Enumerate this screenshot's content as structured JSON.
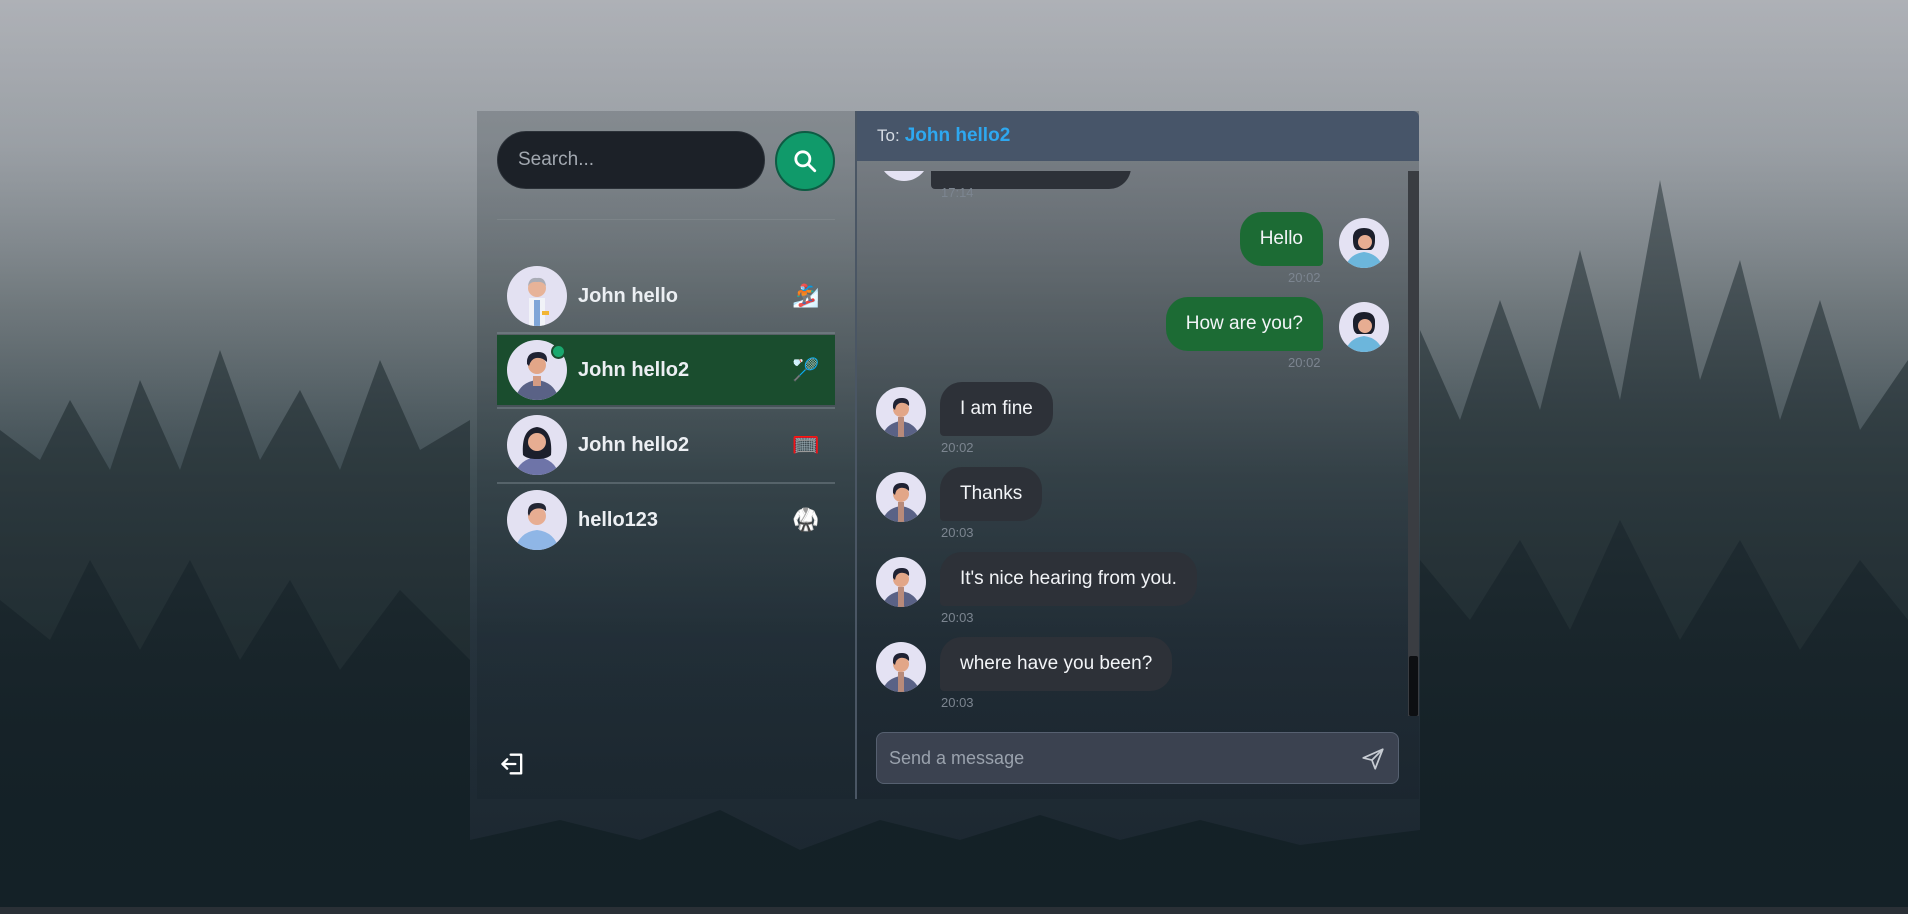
{
  "search": {
    "placeholder": "Search..."
  },
  "contacts": [
    {
      "name": "John hello",
      "emoji": "🏂"
    },
    {
      "name": "John hello2",
      "emoji": "🏸"
    },
    {
      "name": "John hello2",
      "emoji": "🥅"
    },
    {
      "name": "hello123",
      "emoji": "🥋"
    }
  ],
  "chat": {
    "to_label": "To:",
    "recipient": "John hello2",
    "messages": [
      {
        "text": "",
        "time": "17:14",
        "direction": "incoming"
      },
      {
        "text": "Hello",
        "time": "20:02",
        "direction": "outgoing"
      },
      {
        "text": "How are you?",
        "time": "20:02",
        "direction": "outgoing"
      },
      {
        "text": "I am fine",
        "time": "20:02",
        "direction": "incoming"
      },
      {
        "text": "Thanks",
        "time": "20:03",
        "direction": "incoming"
      },
      {
        "text": "It's nice hearing from you.",
        "time": "20:03",
        "direction": "incoming"
      },
      {
        "text": "where have you been?",
        "time": "20:03",
        "direction": "incoming"
      }
    ],
    "input_placeholder": "Send a message"
  },
  "icons": {
    "search": "search-icon",
    "logout": "logout-icon",
    "send": "send-icon"
  },
  "colors": {
    "accent_green": "#109a6a",
    "active_contact": "#1a4d2e",
    "outgoing_bubble": "#1c6b34",
    "incoming_bubble": "#2d3138",
    "header": "#475569",
    "recipient_name": "#2ea8f0"
  }
}
